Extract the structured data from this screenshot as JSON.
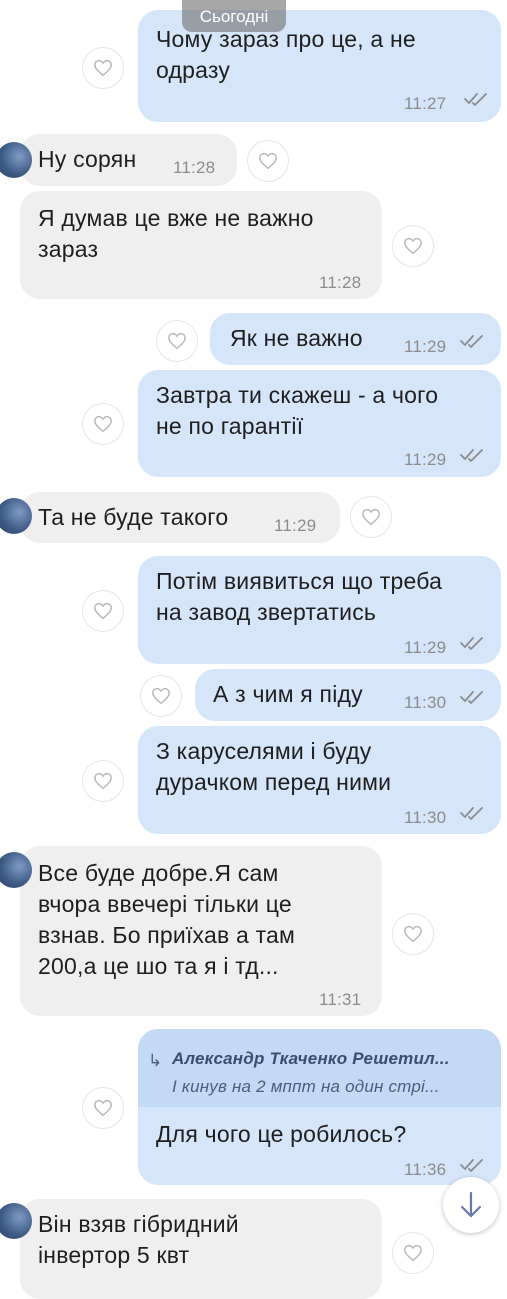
{
  "date_label": "Сьогодні",
  "messages": [
    {
      "dir": "out",
      "text": "Чому зараз про це, а не\nодразу",
      "time": "11:27"
    },
    {
      "dir": "in",
      "text": "Ну сорян",
      "time": "11:28"
    },
    {
      "dir": "in",
      "text": "Я думав це вже не важно\nзараз",
      "time": "11:28"
    },
    {
      "dir": "out",
      "text": "Як не важно",
      "time": "11:29"
    },
    {
      "dir": "out",
      "text": "Завтра ти скажеш - а чого\nне по гарантії",
      "time": "11:29"
    },
    {
      "dir": "in",
      "text": "Та не буде такого",
      "time": "11:29"
    },
    {
      "dir": "out",
      "text": "Потім виявиться що треба\nна завод звертатись",
      "time": "11:29"
    },
    {
      "dir": "out",
      "text": "А з чим я піду",
      "time": "11:30"
    },
    {
      "dir": "out",
      "text": "З каруселями і буду\nдурачком перед ними",
      "time": "11:30"
    },
    {
      "dir": "in",
      "text": "Все буде добре.Я сам\nвчора ввечері тільки це\nвзнав. Бо приїхав а там\n200,а це шо та я і тд...",
      "time": "11:31"
    },
    {
      "dir": "out",
      "text": "Для чого це робилось?",
      "time": "11:36",
      "reply": {
        "author": "Александр Ткаченко Решетил...",
        "snippet": "І кинув на 2 мппт на один стрі..."
      }
    },
    {
      "dir": "in",
      "text": "Він взяв гібридний\nінвертор 5 квт",
      "time": ""
    }
  ],
  "colors": {
    "outgoing": "#d5e5fa",
    "incoming": "#efefef",
    "time": "#8c8c8c"
  },
  "icons": {
    "like": "heart-icon",
    "read": "double-check-icon",
    "scroll": "arrow-down-icon"
  }
}
